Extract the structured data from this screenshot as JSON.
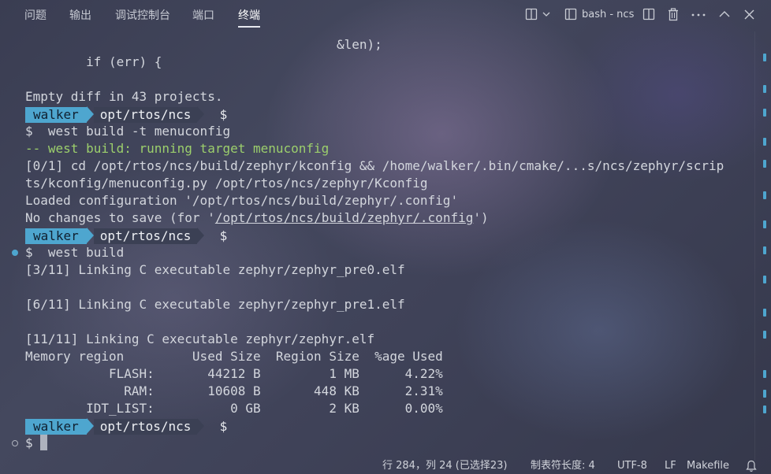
{
  "panel_tabs": [
    {
      "label": "问题",
      "active": false
    },
    {
      "label": "输出",
      "active": false
    },
    {
      "label": "调试控制台",
      "active": false
    },
    {
      "label": "端口",
      "active": false
    },
    {
      "label": "终端",
      "active": true
    }
  ],
  "toolbar": {
    "terminal_name": "bash - ncs",
    "icons": [
      "split-layout-icon",
      "chevron-down-icon",
      "terminal-icon",
      "split-terminal-icon",
      "trash-icon",
      "more-icon",
      "maximize-chevron-up-icon",
      "close-icon"
    ]
  },
  "terminal": {
    "lines": [
      {
        "text": "                                         &len);"
      },
      {
        "text": "        if (err) {"
      },
      {
        "text": ""
      },
      {
        "text": "Empty diff in 43 projects."
      },
      {
        "prompt": true,
        "user": "walker",
        "path": "opt/rtos/ncs",
        "dollar": "$",
        "cmd": ""
      },
      {
        "text": "$  west build -t menuconfig"
      },
      {
        "text": "-- west build: running target menuconfig",
        "color": "green"
      },
      {
        "text": "[0/1] cd /opt/rtos/ncs/build/zephyr/kconfig && /home/walker/.bin/cmake/...s/ncs/zephyr/scrip"
      },
      {
        "text": "ts/kconfig/menuconfig.py /opt/rtos/ncs/zephyr/Kconfig"
      },
      {
        "text": "Loaded configuration '/opt/rtos/ncs/build/zephyr/.config'"
      },
      {
        "pre": "No changes to save (for '",
        "link": "/opt/rtos/ncs/build/zephyr/.config",
        "post": "')"
      },
      {
        "prompt": true,
        "user": "walker",
        "path": "opt/rtos/ncs",
        "dollar": "$",
        "cmd": ""
      },
      {
        "text": "$  west build",
        "marker": "filled"
      },
      {
        "text": "[3/11] Linking C executable zephyr/zephyr_pre0.elf"
      },
      {
        "text": ""
      },
      {
        "text": "[6/11] Linking C executable zephyr/zephyr_pre1.elf"
      },
      {
        "text": ""
      },
      {
        "text": "[11/11] Linking C executable zephyr/zephyr.elf"
      },
      {
        "text": "Memory region         Used Size  Region Size  %age Used"
      },
      {
        "text": "           FLASH:       44212 B         1 MB      4.22%"
      },
      {
        "text": "             RAM:       10608 B       448 KB      2.31%"
      },
      {
        "text": "        IDT_LIST:          0 GB         2 KB      0.00%"
      },
      {
        "prompt": true,
        "user": "walker",
        "path": "opt/rtos/ncs",
        "dollar": "$",
        "cmd": ""
      },
      {
        "text": "$ ",
        "cursor": true,
        "marker": "hollow"
      }
    ]
  },
  "status_bar": {
    "position": "行 284，列 24 (已选择23)",
    "tab_size": "制表符长度: 4",
    "encoding": "UTF-8",
    "eol": "LF",
    "language": "Makefile",
    "bell_icon": "bell-icon"
  },
  "colors": {
    "accent": "#4ea6cf",
    "prompt_path_bg": "#3b4054",
    "green_text": "#9ccf6c"
  }
}
